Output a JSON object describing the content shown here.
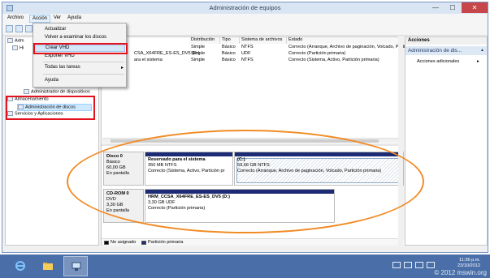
{
  "window": {
    "title": "Administración de equipos",
    "min_glyph": "—",
    "max_glyph": "☐",
    "close_glyph": "✕"
  },
  "menubar": {
    "items": [
      "Archivo",
      "Acción",
      "Ver",
      "Ayuda"
    ],
    "active": "Acción"
  },
  "dropdown": {
    "items": [
      "Actualizar",
      "Volver a examinar los discos",
      "Crear VHD",
      "Exponer VHD",
      "Todas las tareas",
      "Ayuda"
    ],
    "highlighted": "Crear VHD",
    "submenu_arrow": "▸"
  },
  "tree": {
    "rows": [
      "Adm",
      "Hi",
      "Administrador de dispositivos",
      "Almacenamiento",
      "Administración de discos",
      "Servicios y Aplicaciones"
    ],
    "selected": "Administración de discos"
  },
  "volume_table": {
    "columns": [
      "Distribución",
      "Tipo",
      "Sistema de archivos",
      "Estado"
    ],
    "rows": [
      {
        "name": "",
        "layout": "Simple",
        "type": "Básico",
        "fs": "NTFS",
        "status": "Correcto (Arranque, Archivo de paginación, Volcado, Partición p"
      },
      {
        "name": "CSA_X64FRE_ES-ES_DV5 (D:)",
        "layout": "Simple",
        "type": "Básico",
        "fs": "UDF",
        "status": "Correcto (Partición primaria)"
      },
      {
        "name": "ara el sistema",
        "layout": "Simple",
        "type": "Básico",
        "fs": "NTFS",
        "status": "Correcto (Sistema, Activo, Partición primaria)"
      }
    ]
  },
  "disks": [
    {
      "label": "Disco 0",
      "type": "Básico",
      "size": "60,00 GB",
      "state": "En pantalla",
      "partitions": [
        {
          "name": "Reservado para el sistema",
          "size_fs": "350 MB NTFS",
          "status": "Correcto (Sistema, Activo, Partición pr",
          "hatched": false
        },
        {
          "name": "(C:)",
          "size_fs": "59,66 GB NTFS",
          "status": "Correcto (Arranque, Archivo de paginación, Volcado, Partición primaria)",
          "hatched": true
        }
      ]
    },
    {
      "label": "CD-ROM 0",
      "type": "DVD",
      "size": "3,30 GB",
      "state": "En pantalla",
      "partitions": [
        {
          "name": "HRM_CCSA_X64FRE_ES-ES_DV5 (D:)",
          "size_fs": "3,30 GB UDF",
          "status": "Correcto (Partición primaria)",
          "hatched": false
        }
      ]
    }
  ],
  "legend": [
    {
      "label": "No asignado",
      "color": "#000000"
    },
    {
      "label": "Partición primaria",
      "color": "#1c2b73"
    }
  ],
  "actions": {
    "header": "Acciones",
    "section": "Administración de dis...",
    "section_arrow": "▲",
    "more": "Acciones adicionales",
    "more_arrow": "▸"
  },
  "taskbar": {
    "time": "11:36 p.m.",
    "date": "23/10/2012",
    "watermark": "© 2012 mswin.org"
  },
  "colors": {
    "accent": "#4a6fa8",
    "partition_bar": "#1c2b73",
    "highlight_box": "#e2131d",
    "annotation_ellipse": "#f28b25"
  }
}
